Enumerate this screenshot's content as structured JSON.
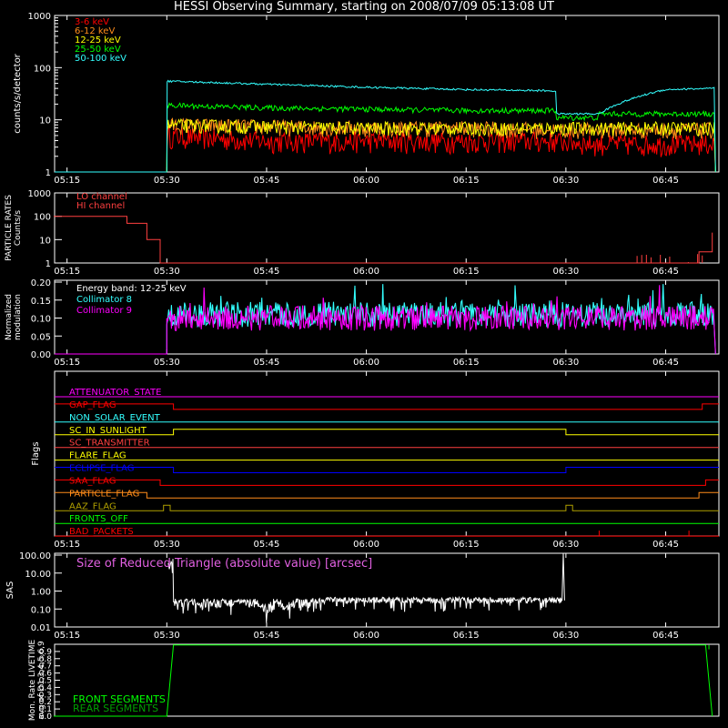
{
  "title": "HESSI Observing Summary, starting on 2008/07/09 05:13:08 UT",
  "colors": {
    "white": "#ffffff",
    "red": "#ff0000",
    "orange": "#ff8c1a",
    "yellow": "#ffff00",
    "green": "#00ff00",
    "cyan": "#33ffff",
    "magenta": "#ff00ff",
    "blue": "#0000ff",
    "olive": "#b0a000",
    "salmon": "#ff4040",
    "darkgreen": "#00a000",
    "violet": "#e060e0"
  },
  "time_axis": {
    "start": "05:13",
    "end": "06:53",
    "ticks": [
      "05:15",
      "05:30",
      "05:45",
      "06:00",
      "06:15",
      "06:30",
      "06:45"
    ]
  },
  "panels": {
    "rates": {
      "ylabel": "counts/s/detector",
      "yticks": [
        "1",
        "10",
        "100",
        "1000"
      ],
      "legend": [
        {
          "label": "3-6 keV",
          "color": "#ff0000"
        },
        {
          "label": "6-12 keV",
          "color": "#ff8c1a"
        },
        {
          "label": "12-25 keV",
          "color": "#ffff00"
        },
        {
          "label": "25-50 keV",
          "color": "#00ff00"
        },
        {
          "label": "50-100 keV",
          "color": "#33ffff"
        }
      ]
    },
    "particle": {
      "ylabel1": "PARTICLE RATES",
      "ylabel2": "Counts/s",
      "yticks": [
        "1",
        "10",
        "100",
        "1000"
      ],
      "legend": [
        {
          "label": "LO channel",
          "color": "#ff4040"
        },
        {
          "label": "HI channel",
          "color": "#ff4040"
        }
      ]
    },
    "modulation": {
      "ylabel1": "Normalized",
      "ylabel2": "modulation",
      "yticks": [
        "0.00",
        "0.05",
        "0.10",
        "0.15",
        "0.20"
      ],
      "legend": [
        {
          "label": "Energy band: 12-25 keV",
          "color": "#ffffff"
        },
        {
          "label": "Collimator 8",
          "color": "#33ffff"
        },
        {
          "label": "Collimator 9",
          "color": "#ff00ff"
        }
      ]
    },
    "flags": {
      "ylabel": "Flags",
      "items": [
        {
          "label": "ATTENUATOR_STATE",
          "color": "#ff00ff"
        },
        {
          "label": "GAP_FLAG",
          "color": "#ff0000"
        },
        {
          "label": "NON_SOLAR_EVENT",
          "color": "#33ffff"
        },
        {
          "label": "SC_IN_SUNLIGHT",
          "color": "#ffff00"
        },
        {
          "label": "SC_TRANSMITTER",
          "color": "#ff4040"
        },
        {
          "label": "FLARE_FLAG",
          "color": "#ffff00"
        },
        {
          "label": "ECLIPSE_FLAG",
          "color": "#0000ff"
        },
        {
          "label": "SAA_FLAG",
          "color": "#ff0000"
        },
        {
          "label": "PARTICLE_FLAG",
          "color": "#ff8c1a"
        },
        {
          "label": "AAZ_FLAG",
          "color": "#b0a000"
        },
        {
          "label": "FRONTS_OFF",
          "color": "#00ff00"
        },
        {
          "label": "BAD_PACKETS",
          "color": "#ff0000"
        }
      ]
    },
    "sas": {
      "ylabel": "SAS",
      "yticks": [
        "0.01",
        "0.10",
        "1.00",
        "10.00",
        "100.00"
      ],
      "label": "Size of Reduced Triangle (absolute value) [arcsec]"
    },
    "livetime": {
      "ylabel1": "Mon. Rate LIVETIME",
      "ylabel2": "avg of D1,3,4,5,6,9",
      "yticks": [
        "0.0",
        "0.1",
        "0.2",
        "0.3",
        "0.4",
        "0.5",
        "0.6",
        "0.7",
        "0.8",
        "0.9"
      ],
      "legend": [
        {
          "label": "FRONT SEGMENTS",
          "color": "#00ff00"
        },
        {
          "label": "REAR SEGMENTS",
          "color": "#00a000"
        }
      ]
    }
  },
  "chart_data": [
    {
      "type": "line",
      "title": "",
      "ylabel": "counts/s/detector",
      "yscale": "log",
      "ylim": [
        1,
        1000
      ],
      "x": [
        "05:30",
        "05:45",
        "06:00",
        "06:15",
        "06:28",
        "06:35",
        "06:45",
        "06:52"
      ],
      "series": [
        {
          "name": "3-6 keV",
          "values": [
            5,
            4,
            4,
            4,
            4,
            3.5,
            3.5,
            3.5
          ]
        },
        {
          "name": "6-12 keV",
          "values": [
            8,
            7.5,
            7,
            7,
            6.5,
            6.5,
            6.5,
            6.5
          ]
        },
        {
          "name": "12-25 keV",
          "values": [
            8,
            7.5,
            7,
            7,
            7,
            7,
            7,
            7
          ]
        },
        {
          "name": "25-50 keV",
          "values": [
            19,
            17,
            16,
            15,
            15,
            13,
            13,
            13
          ]
        },
        {
          "name": "50-100 keV",
          "values": [
            55,
            48,
            42,
            38,
            36,
            13,
            38,
            40
          ]
        }
      ]
    },
    {
      "type": "line",
      "title": "",
      "ylabel": "Counts/s",
      "yscale": "log",
      "ylim": [
        1,
        1000
      ],
      "x": [
        "05:13",
        "05:20",
        "05:24",
        "05:27",
        "05:29",
        "06:48",
        "06:50",
        "06:52"
      ],
      "series": [
        {
          "name": "LO channel",
          "values": [
            100,
            100,
            50,
            10,
            1,
            1,
            3,
            20
          ]
        }
      ]
    },
    {
      "type": "line",
      "title": "",
      "ylabel": "modulation",
      "ylim": [
        0,
        0.2
      ],
      "x": [
        "05:30",
        "05:45",
        "06:00",
        "06:15",
        "06:30",
        "06:45"
      ],
      "series": [
        {
          "name": "Collimator 8",
          "values": [
            0.11,
            0.1,
            0.1,
            0.1,
            0.1,
            0.1
          ]
        },
        {
          "name": "Collimator 9",
          "values": [
            0.1,
            0.1,
            0.1,
            0.1,
            0.1,
            0.1
          ]
        }
      ]
    },
    {
      "type": "line",
      "title": "",
      "ylabel": "SAS",
      "yscale": "log",
      "ylim": [
        0.01,
        100
      ],
      "x": [
        "05:30",
        "05:40",
        "05:46",
        "05:52",
        "06:15",
        "06:29"
      ],
      "series": [
        {
          "name": "",
          "values": [
            0.25,
            0.2,
            0.03,
            0.3,
            0.35,
            0.3
          ]
        }
      ]
    },
    {
      "type": "line",
      "title": "",
      "ylabel": "LIVETIME",
      "ylim": [
        0,
        1
      ],
      "x": [
        "05:13",
        "05:30",
        "05:31",
        "06:51",
        "06:52"
      ],
      "series": [
        {
          "name": "FRONT SEGMENTS",
          "values": [
            0,
            0,
            0.99,
            0.99,
            0
          ]
        }
      ]
    }
  ]
}
